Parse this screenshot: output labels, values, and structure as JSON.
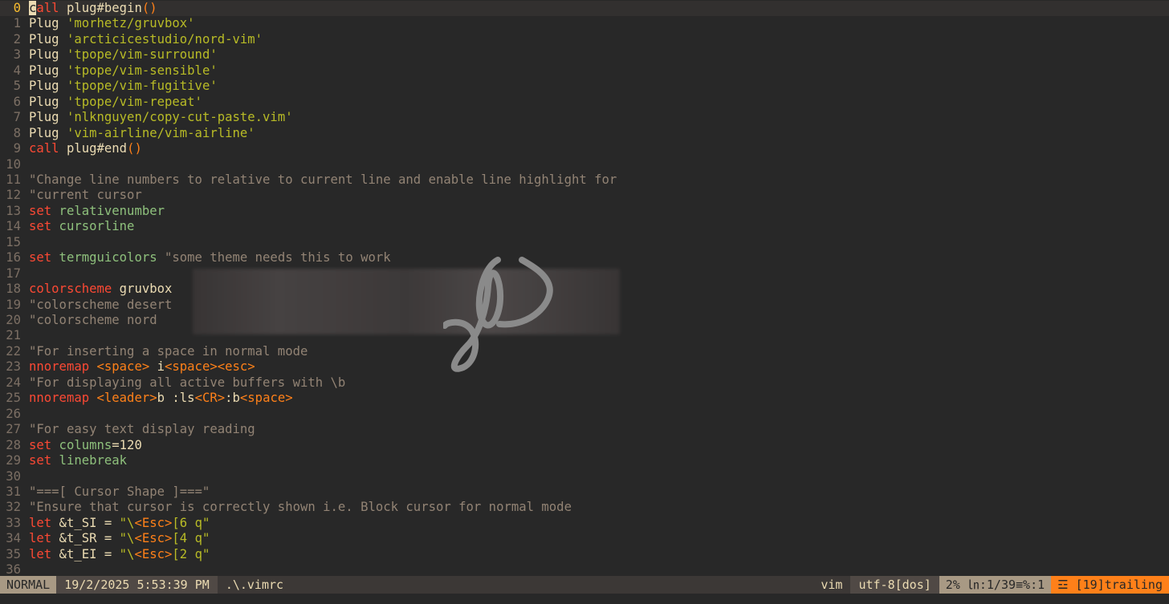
{
  "editor": {
    "lines": [
      {
        "n": "0",
        "current": true,
        "tokens": [
          {
            "c": "cursor",
            "t": "c"
          },
          {
            "c": "kw",
            "t": "all"
          },
          {
            "c": "fn",
            "t": " plug#begin"
          },
          {
            "c": "paren",
            "t": "()"
          }
        ]
      },
      {
        "n": "1",
        "tokens": [
          {
            "c": "fn",
            "t": "Plug "
          },
          {
            "c": "str",
            "t": "'morhetz/gruvbox'"
          }
        ]
      },
      {
        "n": "2",
        "tokens": [
          {
            "c": "fn",
            "t": "Plug "
          },
          {
            "c": "str",
            "t": "'arcticicestudio/nord-vim'"
          }
        ]
      },
      {
        "n": "3",
        "tokens": [
          {
            "c": "fn",
            "t": "Plug "
          },
          {
            "c": "str",
            "t": "'tpope/vim-surround'"
          }
        ]
      },
      {
        "n": "4",
        "tokens": [
          {
            "c": "fn",
            "t": "Plug "
          },
          {
            "c": "str",
            "t": "'tpope/vim-sensible'"
          }
        ]
      },
      {
        "n": "5",
        "tokens": [
          {
            "c": "fn",
            "t": "Plug "
          },
          {
            "c": "str",
            "t": "'tpope/vim-fugitive'"
          }
        ]
      },
      {
        "n": "6",
        "tokens": [
          {
            "c": "fn",
            "t": "Plug "
          },
          {
            "c": "str",
            "t": "'tpope/vim-repeat'"
          }
        ]
      },
      {
        "n": "7",
        "tokens": [
          {
            "c": "fn",
            "t": "Plug "
          },
          {
            "c": "str",
            "t": "'nlknguyen/copy-cut-paste.vim'"
          }
        ]
      },
      {
        "n": "8",
        "tokens": [
          {
            "c": "fn",
            "t": "Plug "
          },
          {
            "c": "str",
            "t": "'vim-airline/vim-airline'"
          }
        ]
      },
      {
        "n": "9",
        "tokens": [
          {
            "c": "kw",
            "t": "call"
          },
          {
            "c": "fn",
            "t": " plug#end"
          },
          {
            "c": "paren",
            "t": "()"
          }
        ]
      },
      {
        "n": "10",
        "tokens": []
      },
      {
        "n": "11",
        "tokens": [
          {
            "c": "cmt",
            "t": "\"Change line numbers to relative to current line and enable line highlight for"
          }
        ]
      },
      {
        "n": "12",
        "tokens": [
          {
            "c": "cmt",
            "t": "\"current cursor"
          }
        ]
      },
      {
        "n": "13",
        "tokens": [
          {
            "c": "kw",
            "t": "set"
          },
          {
            "c": "opt",
            "t": " relativenumber"
          }
        ]
      },
      {
        "n": "14",
        "tokens": [
          {
            "c": "kw",
            "t": "set"
          },
          {
            "c": "opt",
            "t": " cursorline"
          }
        ]
      },
      {
        "n": "15",
        "tokens": []
      },
      {
        "n": "16",
        "tokens": [
          {
            "c": "kw",
            "t": "set"
          },
          {
            "c": "opt",
            "t": " termguicolors"
          },
          {
            "c": "cmt",
            "t": " \"some theme needs this to work"
          }
        ]
      },
      {
        "n": "17",
        "tokens": []
      },
      {
        "n": "18",
        "tokens": [
          {
            "c": "kw",
            "t": "colorscheme"
          },
          {
            "c": "fn",
            "t": " gruvbox"
          }
        ]
      },
      {
        "n": "19",
        "tokens": [
          {
            "c": "cmt",
            "t": "\"colorscheme desert"
          }
        ]
      },
      {
        "n": "20",
        "tokens": [
          {
            "c": "cmt",
            "t": "\"colorscheme nord"
          }
        ]
      },
      {
        "n": "21",
        "tokens": []
      },
      {
        "n": "22",
        "tokens": [
          {
            "c": "cmt",
            "t": "\"For inserting a space in normal mode"
          }
        ]
      },
      {
        "n": "23",
        "tokens": [
          {
            "c": "kw",
            "t": "nnoremap"
          },
          {
            "c": "fn",
            "t": " "
          },
          {
            "c": "spc",
            "t": "<space>"
          },
          {
            "c": "fn",
            "t": " i"
          },
          {
            "c": "spc",
            "t": "<space><esc>"
          }
        ]
      },
      {
        "n": "24",
        "tokens": [
          {
            "c": "cmt",
            "t": "\"For displaying all active buffers with \\b"
          }
        ]
      },
      {
        "n": "25",
        "tokens": [
          {
            "c": "kw",
            "t": "nnoremap"
          },
          {
            "c": "fn",
            "t": " "
          },
          {
            "c": "spc",
            "t": "<leader>"
          },
          {
            "c": "fn",
            "t": "b :ls"
          },
          {
            "c": "spc",
            "t": "<CR>"
          },
          {
            "c": "fn",
            "t": ":b"
          },
          {
            "c": "spc",
            "t": "<space>"
          }
        ]
      },
      {
        "n": "26",
        "tokens": []
      },
      {
        "n": "27",
        "tokens": [
          {
            "c": "cmt",
            "t": "\"For easy text display reading"
          }
        ]
      },
      {
        "n": "28",
        "tokens": [
          {
            "c": "kw",
            "t": "set"
          },
          {
            "c": "opt",
            "t": " columns"
          },
          {
            "c": "fn",
            "t": "="
          },
          {
            "c": "fn",
            "t": "120"
          }
        ]
      },
      {
        "n": "29",
        "tokens": [
          {
            "c": "kw",
            "t": "set"
          },
          {
            "c": "opt",
            "t": " linebreak"
          }
        ]
      },
      {
        "n": "30",
        "tokens": []
      },
      {
        "n": "31",
        "tokens": [
          {
            "c": "cmt",
            "t": "\"===[ Cursor Shape ]===\""
          }
        ]
      },
      {
        "n": "32",
        "tokens": [
          {
            "c": "cmt",
            "t": "\"Ensure that cursor is correctly shown i.e. Block cursor for normal mode"
          }
        ]
      },
      {
        "n": "33",
        "tokens": [
          {
            "c": "kw",
            "t": "let"
          },
          {
            "c": "fn",
            "t": " &t_SI = "
          },
          {
            "c": "str",
            "t": "\"\\"
          },
          {
            "c": "esc",
            "t": "<Esc>"
          },
          {
            "c": "str",
            "t": "[6 q\""
          }
        ]
      },
      {
        "n": "34",
        "tokens": [
          {
            "c": "kw",
            "t": "let"
          },
          {
            "c": "fn",
            "t": " &t_SR = "
          },
          {
            "c": "str",
            "t": "\"\\"
          },
          {
            "c": "esc",
            "t": "<Esc>"
          },
          {
            "c": "str",
            "t": "[4 q\""
          }
        ]
      },
      {
        "n": "35",
        "tokens": [
          {
            "c": "kw",
            "t": "let"
          },
          {
            "c": "fn",
            "t": " &t_EI = "
          },
          {
            "c": "str",
            "t": "\"\\"
          },
          {
            "c": "esc",
            "t": "<Esc>"
          },
          {
            "c": "str",
            "t": "[2 q\""
          }
        ]
      },
      {
        "n": "36",
        "tokens": []
      }
    ]
  },
  "statusline": {
    "mode": "NORMAL",
    "datetime": "19/2/2025 5:53:39 PM",
    "filename": ".\\.vimrc",
    "filetype": "vim",
    "encoding": "utf-8[dos]",
    "position": "2% ㏑:1/39≡%:1",
    "warning": "☲ [19]trailing"
  },
  "colors": {
    "background": "#282828",
    "keyword": "#fb4934",
    "string": "#b8bb26",
    "comment": "#928374",
    "option": "#8ec07c",
    "special": "#fe8019"
  }
}
